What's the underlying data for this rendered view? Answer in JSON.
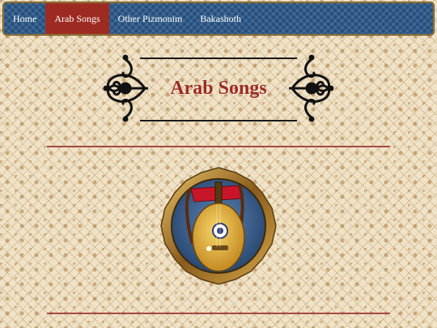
{
  "navbar": {
    "items": [
      {
        "label": "Home",
        "active": false
      },
      {
        "label": "Arab Songs",
        "active": true
      },
      {
        "label": "Other Pizmonim",
        "active": false
      },
      {
        "label": "Bakashoth",
        "active": false
      }
    ]
  },
  "page": {
    "title": "Arab Songs"
  },
  "image": {
    "subject": "oud-on-chair-icon"
  },
  "colors": {
    "nav_background": "#24507f",
    "nav_active": "#9d2b22",
    "title": "#9b2b24",
    "divider": "#a5483e",
    "page_background": "#efe2c6"
  }
}
